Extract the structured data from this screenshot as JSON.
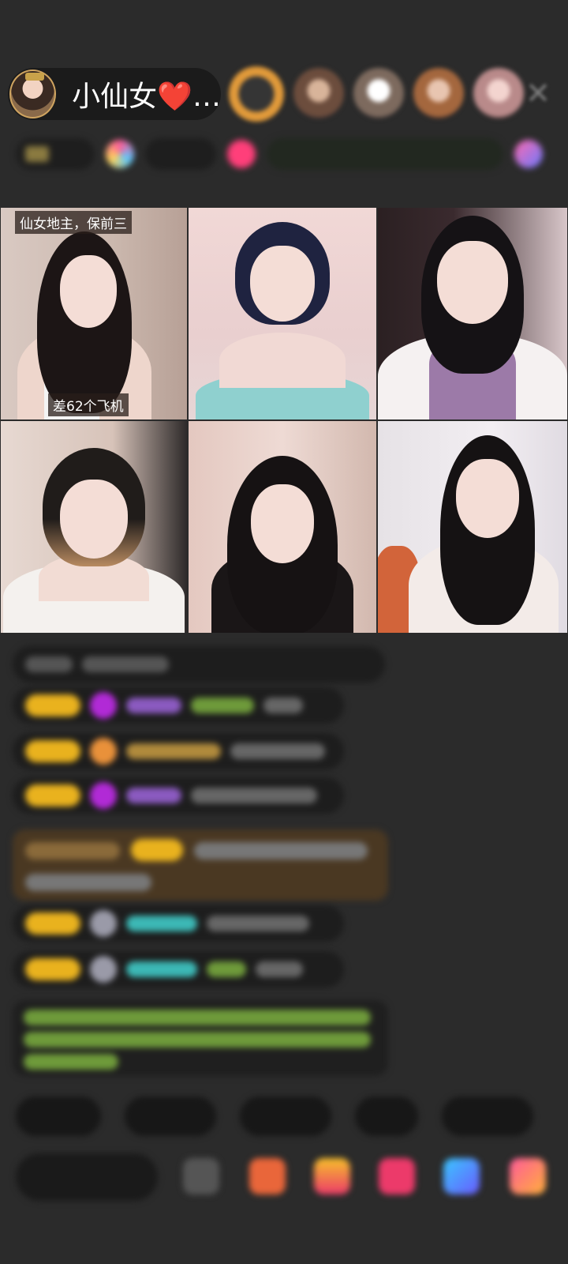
{
  "header": {
    "host_name": "小仙女❤️…",
    "close_symbol": "✕"
  },
  "grid": {
    "cell1_tag_top": "仙女地主，保前三",
    "cell1_tag_bottom": "差62个飞机"
  },
  "colors": {
    "background": "#2b2b2b",
    "badge_gold": "#e9b21e",
    "highlight_brown": "#4a3822",
    "text_green": "#8bbf3c",
    "text_cyan": "#3cb8b5"
  },
  "icons": [
    "close-icon",
    "gem-icon",
    "gift-icon",
    "share-icon",
    "more-icon"
  ]
}
